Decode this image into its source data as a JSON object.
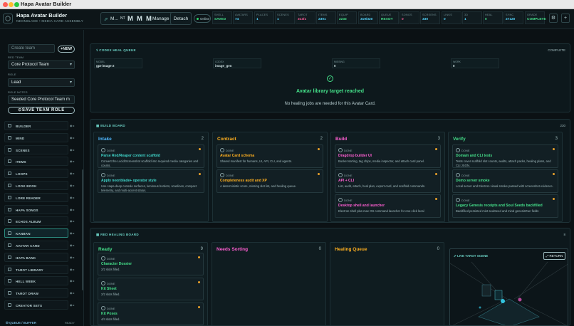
{
  "window": {
    "title": "Hapa Avatar Builder"
  },
  "header": {
    "title": "Hapa Avatar Builder",
    "subtitle": "NEONBLADE • MEDIA CARD ASSEMBLY",
    "mode_short": "M...",
    "mode_num": "NT",
    "m1": "M",
    "m2": "M",
    "m3": "M",
    "manage": "Manage",
    "detach": "Detach",
    "online": "Online"
  },
  "stats": [
    {
      "label": "SHELL",
      "value": "SAVED",
      "color": "#45e08a"
    },
    {
      "label": "AVATARS",
      "value": "74",
      "color": "#54d7ff"
    },
    {
      "label": "PLACES",
      "value": "1",
      "color": "#54d7ff"
    },
    {
      "label": "SCENES",
      "value": "1",
      "color": "#54d7ff"
    },
    {
      "label": "TAROT",
      "value": "313/1",
      "color": "#ff5c9a"
    },
    {
      "label": "ITEMS",
      "value": "2301",
      "color": "#54d7ff"
    },
    {
      "label": "EQUIP",
      "value": "2233",
      "color": "#45e08a"
    },
    {
      "label": "BOARD",
      "value": "319/320",
      "color": "#54d7ff"
    },
    {
      "label": "QUEUE",
      "value": "READY",
      "color": "#45e08a"
    },
    {
      "label": "SONGS",
      "value": "0",
      "color": "#ff5c9a"
    },
    {
      "label": "SCREENS",
      "value": "330",
      "color": "#54d7ff"
    },
    {
      "label": "LINKS",
      "value": "0",
      "color": "#54d7ff"
    },
    {
      "label": "3D",
      "value": "1",
      "color": "#54d7ff"
    },
    {
      "label": "HEAL",
      "value": "0",
      "color": "#45e08a"
    },
    {
      "label": "SYNC",
      "value": "27120",
      "color": "#54d7ff"
    },
    {
      "label": "GRADE",
      "value": "COMPLETE",
      "color": "#45e08a"
    }
  ],
  "sidebar": {
    "create_placeholder": "Create team",
    "new_button": "+NEW",
    "red_team_label": "RED TEAM",
    "team_select": "Core Protocol Team",
    "role_label": "ROLE",
    "role_select": "Lead",
    "notes_label": "ROLE NOTES",
    "notes_value": "Seeded Core Protocol Team m",
    "save_button": "SAVE TEAM ROLE",
    "items": [
      {
        "label": "BUILDER"
      },
      {
        "label": "MIND"
      },
      {
        "label": "SCENES"
      },
      {
        "label": "ITEMS"
      },
      {
        "label": "LOOPS"
      },
      {
        "label": "LOOK BOOK"
      },
      {
        "label": "LORE READER"
      },
      {
        "label": "HAPA SONGS"
      },
      {
        "label": "ECHOS ALBUM"
      },
      {
        "label": "KANBAN"
      },
      {
        "label": "AVATAR CARD"
      },
      {
        "label": "HAPA BANK"
      },
      {
        "label": "TAROT LIBRARY"
      },
      {
        "label": "HELL WEEK"
      },
      {
        "label": "TAROT DRAW"
      },
      {
        "label": "CREATOR SETS"
      }
    ],
    "queue_label": "QUEUE / BUFFER",
    "queue_status": "READY"
  },
  "heal": {
    "title": "CODEX HEAL QUEUE",
    "status": "COMPLETE",
    "stats": [
      {
        "label": "MODEL",
        "value": "gpt-image-2"
      },
      {
        "label": "CODEX",
        "value": "image_gen"
      },
      {
        "label": "MISSING",
        "value": "0"
      },
      {
        "label": "WORK",
        "value": "0"
      }
    ],
    "message": "Avatar library target reached",
    "sub": "No healing jobs are needed for this Avatar Card."
  },
  "board": {
    "title": "BUILD BOARD",
    "count": "230",
    "columns": [
      {
        "name": "Intake",
        "count": "2",
        "color": "#4fb8ff",
        "cards": [
          {
            "status": "DONE",
            "title": "Parse Red/Reaper content scaffold",
            "desc": "Convert the Lucid/Screenshot scaffold into required media categories and counts."
          },
          {
            "status": "DONE",
            "title": "Apply neonblade+ operator style",
            "desc": "Use Hapa deep console surfaces, luminous borders, scanlines, compact telemetry, and multi-accent status."
          }
        ]
      },
      {
        "name": "Contract",
        "count": "2",
        "color": "#ffb020",
        "cards": [
          {
            "status": "DONE",
            "title": "Avatar Card schema",
            "desc": "Shared manifest for humans, UI, API, CLI, and agents."
          },
          {
            "status": "DONE",
            "title": "Completeness audit and XP",
            "desc": "A deterministic score, missing slot list, and healing queue."
          }
        ]
      },
      {
        "name": "Build",
        "count": "3",
        "color": "#ff5fd2",
        "cards": [
          {
            "status": "DONE",
            "title": "Dragdrop builder UI",
            "desc": "Bucket sorting, tag chips, media inspector, and attach card panel."
          },
          {
            "status": "DONE",
            "title": "API + CLI",
            "desc": "List, audit, attach, heal plan, export-card, and scaffold commands."
          },
          {
            "status": "DONE",
            "title": "Desktop shell and launcher",
            "desc": "Electron shell plus mac OS command launcher for one-click local"
          }
        ]
      },
      {
        "name": "Verify",
        "count": "3",
        "color": "#45e08a",
        "cards": [
          {
            "status": "DONE",
            "title": "Domain and CLI tests",
            "desc": "Tests cover scaffold slot counts, audits, attach packs, healing plans, and CLI JSON."
          },
          {
            "status": "DONE",
            "title": "Demo server smoke",
            "desc": "Local server and Electron visual smoke passed with screenshot evidence."
          },
          {
            "status": "DONE",
            "title": "Legacy Genesis receipts and Soul Seeds backfilled",
            "desc": "Backfilled persisted mint soulSeed and mind genesisRun fields"
          }
        ]
      }
    ]
  },
  "redheal": {
    "title": "RED HEALING BOARD",
    "count": "8",
    "columns": [
      {
        "name": "Ready",
        "count": "9",
        "color": "#45e08a",
        "cards": [
          {
            "status": "DONE",
            "title": "Character Dossier",
            "desc": "2/2 slots filled."
          },
          {
            "status": "DONE",
            "title": "Kit Sheet",
            "desc": "2/2 slots filled."
          },
          {
            "status": "DONE",
            "title": "Kit Poses",
            "desc": "4/4 slots filled."
          }
        ]
      },
      {
        "name": "Needs Sorting",
        "count": "0",
        "color": "#ff5fd2",
        "cards": []
      },
      {
        "name": "Healing Queue",
        "count": "0",
        "color": "#ffb020",
        "cards": []
      }
    ],
    "live": {
      "title": "LIVE TAROT SCENE",
      "return": "RETURN"
    }
  }
}
